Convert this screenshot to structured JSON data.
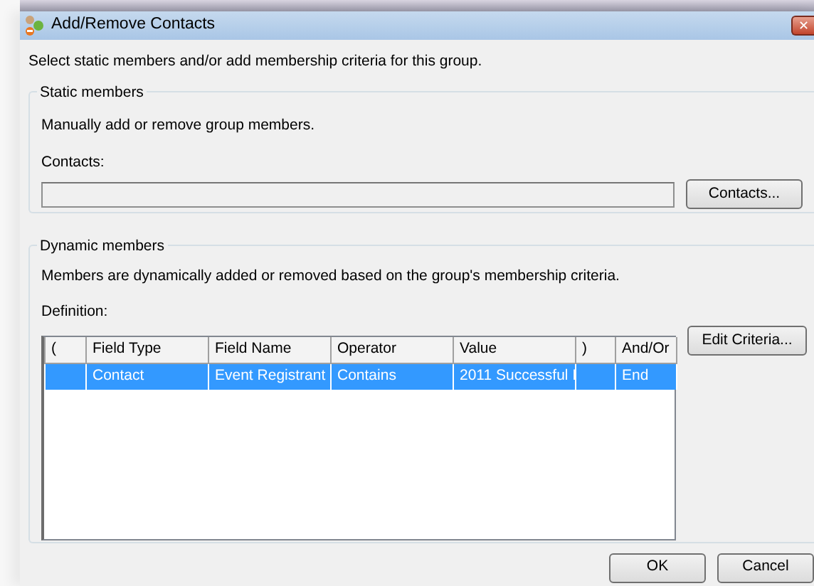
{
  "window": {
    "title": "Add/Remove Contacts",
    "close_label": "✕"
  },
  "instructions": "Select static members and/or add membership criteria for this group.",
  "static_members": {
    "legend": "Static members",
    "description": "Manually add or remove group members.",
    "field_label": "Contacts:",
    "button": "Contacts..."
  },
  "dynamic_members": {
    "legend": "Dynamic members",
    "description": "Members are dynamically added or removed based on the group's membership criteria.",
    "definition_label": "Definition:",
    "button": "Edit Criteria...",
    "table": {
      "columns": [
        "(",
        "Field Type",
        "Field Name",
        "Operator",
        "Value",
        ")",
        "And/Or"
      ],
      "rows": [
        {
          "cells": [
            "",
            "Contact",
            "Event Registrant",
            "Contains",
            "2011 Successful I",
            "",
            "End"
          ],
          "selected": true
        }
      ]
    }
  },
  "buttons": [
    "OK",
    "Cancel"
  ]
}
